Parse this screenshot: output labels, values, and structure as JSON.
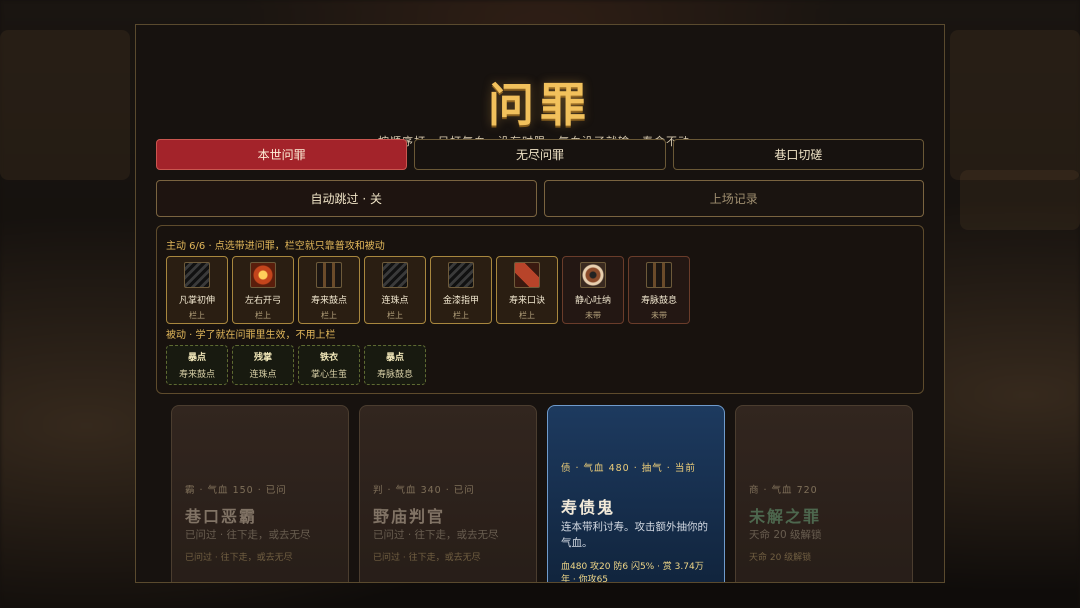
{
  "title": "问罪",
  "subtitle": "按顺序打。只打气血，没有时限。气血没了就输，寿命不动。",
  "tabs": [
    {
      "label": "本世问罪",
      "active": true
    },
    {
      "label": "无尽问罪",
      "active": false
    },
    {
      "label": "巷口切磋",
      "active": false
    }
  ],
  "actions": {
    "auto_skip": "自动跳过 · 关",
    "records": "上场记录"
  },
  "active_hint": "主动 6/6 · 点选带进问罪，栏空就只靠普攻和被动",
  "active_skills": [
    {
      "name": "凡掌初伸",
      "state": "栏上",
      "icon": "hatched-scroll-icon",
      "equipped": true
    },
    {
      "name": "左右开弓",
      "state": "栏上",
      "icon": "fire-gem-icon",
      "equipped": true
    },
    {
      "name": "寿来鼓点",
      "state": "栏上",
      "icon": "drum-pillar-icon",
      "equipped": true
    },
    {
      "name": "连珠点",
      "state": "栏上",
      "icon": "hatched-scroll-icon",
      "equipped": true
    },
    {
      "name": "金漆指甲",
      "state": "栏上",
      "icon": "hatched-scroll-icon",
      "equipped": true
    },
    {
      "name": "寿来口诀",
      "state": "栏上",
      "icon": "red-book-icon",
      "equipped": true
    },
    {
      "name": "静心吐纳",
      "state": "未带",
      "icon": "eye-orb-icon",
      "equipped": false
    },
    {
      "name": "寿脉鼓息",
      "state": "未带",
      "icon": "drum-pillar-icon",
      "equipped": false
    }
  ],
  "passive_hint": "被动 · 学了就在问罪里生效，不用上栏",
  "passives": [
    {
      "name": "暴点",
      "source": "寿来鼓点"
    },
    {
      "name": "残掌",
      "source": "连珠点"
    },
    {
      "name": "铁衣",
      "source": "掌心生茧"
    },
    {
      "name": "暴点",
      "source": "寿脉鼓息"
    }
  ],
  "opponents": [
    {
      "meta": "霸 · 气血 150 · 已问",
      "name": "巷口恶霸",
      "desc": "已问过 · 往下走，或去无尽",
      "foot": "已问过 · 往下走，或去无尽",
      "status": "done"
    },
    {
      "meta": "判 · 气血 340 · 已问",
      "name": "野庙判官",
      "desc": "已问过 · 往下走，或去无尽",
      "foot": "已问过 · 往下走，或去无尽",
      "status": "done"
    },
    {
      "meta": "债 · 气血 480 · 抽气 · 当前",
      "name": "寿债鬼",
      "desc": "连本带利讨寿。攻击额外抽你的气血。",
      "foot": "血480 攻20 防6 闪5% · 赏 3.74万 年 · 你攻65",
      "status": "current"
    },
    {
      "meta": "商 · 气血 720",
      "name": "未解之罪",
      "desc": "天命 20 级解锁",
      "foot": "天命 20 级解锁",
      "status": "locked"
    }
  ],
  "colors": {
    "accent_gold": "#f2c15c",
    "active_tab": "#a3232a",
    "current_card": "#1d3a5f"
  }
}
